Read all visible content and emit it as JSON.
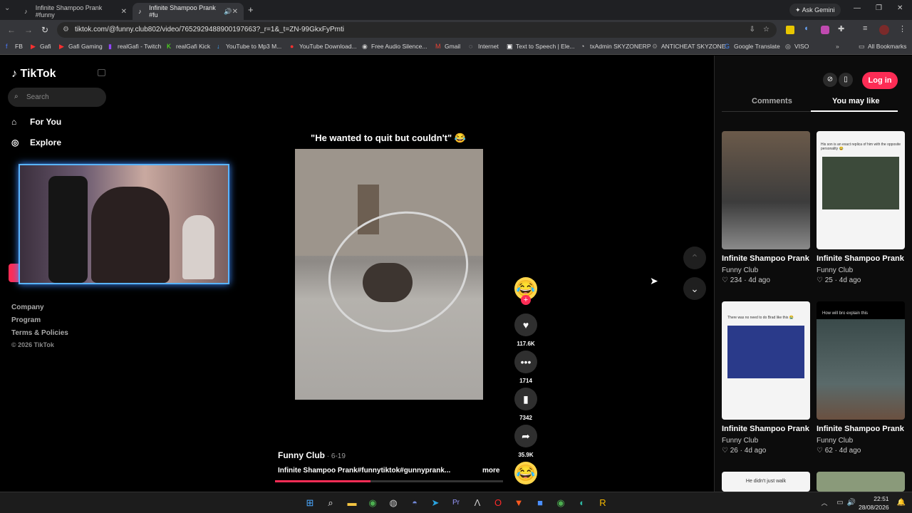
{
  "browser": {
    "tabs": [
      {
        "label": "Infinite Shampoo Prank #funny"
      },
      {
        "label": "Infinite Shampoo Prank #fu"
      }
    ],
    "url": "tiktok.com/@funny.club802/video/7652929488900197663?_r=1&_t=ZN-99GkxFyPmti",
    "ask_gemini": "Ask Gemini",
    "bookmarks": [
      "FB",
      "Gafi",
      "Gafi Gaming",
      "realGafi - Twitch",
      "realGafi Kick",
      "YouTube to Mp3 M...",
      "YouTube Download...",
      "Free Audio Silence...",
      "Gmail",
      "Internet",
      "Text to Speech | Ele...",
      "txAdmin SKYZONERP",
      "ANTICHEAT SKYZONE",
      "Google Translate",
      "VISO"
    ],
    "all_bookmarks": "All Bookmarks"
  },
  "sidebar": {
    "logo": "TikTok",
    "search_placeholder": "Search",
    "nav": [
      "For You",
      "Explore"
    ],
    "footer": [
      "Company",
      "Program",
      "Terms & Policies",
      "© 2026 TikTok"
    ]
  },
  "video": {
    "caption": "\"He wanted to quit but couldn't\" 😂",
    "author": "Funny Club",
    "date": " · 6-19",
    "description": "Infinite Shampoo Prank#funnytiktok#gunnyprank...",
    "more": "more",
    "progress": 0.42,
    "likes": "117.6K",
    "comments": "1714",
    "saves": "7342",
    "shares": "35.9K"
  },
  "right_panel": {
    "login": "Log in",
    "tabs": [
      "Comments",
      "You may like"
    ],
    "cards": [
      {
        "title": "Infinite Shampoo Prank #funnytiktok#gunnyp...",
        "author": "Funny Club",
        "meta": "♡ 234 · 4d ago"
      },
      {
        "title": "Infinite Shampoo Prank #funnytiktok#gunnyp...",
        "author": "Funny Club",
        "meta": "♡ 25 · 4d ago"
      },
      {
        "title": "Infinite Shampoo Prank #funnytiktok#gunnyp...",
        "author": "Funny Club",
        "meta": "♡ 26 · 4d ago"
      },
      {
        "title": "Infinite Shampoo Prank #funnytiktok#gunnyp...",
        "author": "Funny Club",
        "meta": "♡ 62 · 4d ago"
      }
    ],
    "thumb_texts": [
      "His son is an exact replica of him with the opposite personality 😂",
      "There was no need to do Brad like this 😭",
      "How will bro explain this",
      "He didn't just walk"
    ]
  },
  "taskbar": {
    "time": "22:51",
    "date": "28/08/2026"
  }
}
